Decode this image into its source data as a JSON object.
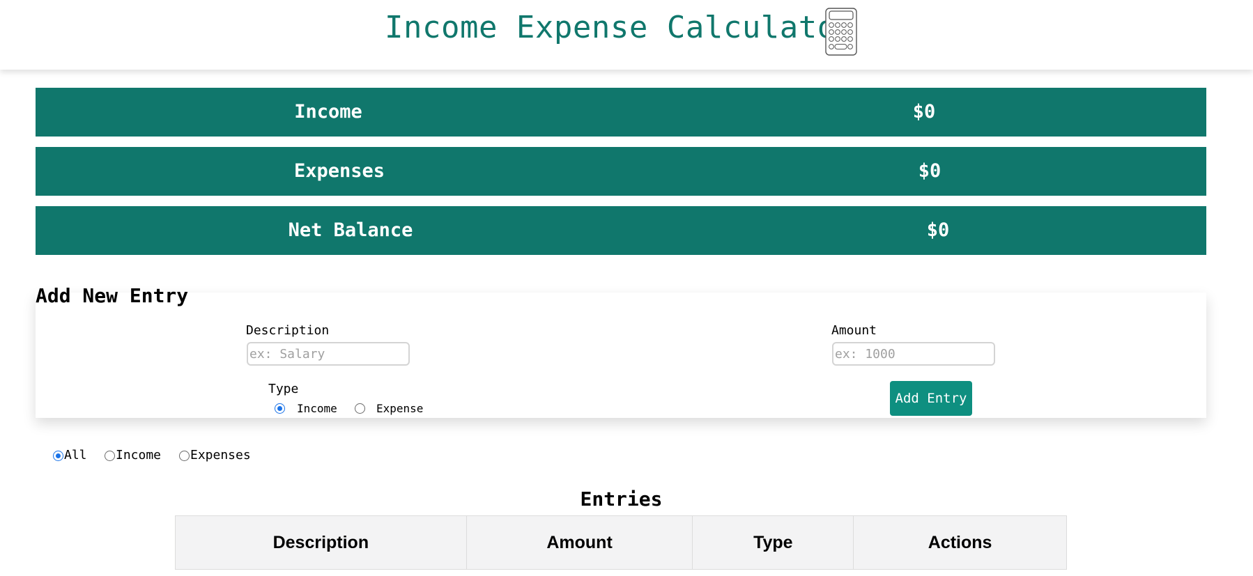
{
  "header": {
    "title": "Income Expense Calculator",
    "icon": "calculator-icon"
  },
  "summary": {
    "income": {
      "label": "Income",
      "value": "$0"
    },
    "expenses": {
      "label": "Expenses",
      "value": "$0"
    },
    "net_balance": {
      "label": "Net Balance",
      "value": "$0"
    }
  },
  "form": {
    "title": "Add New Entry",
    "description_label": "Description",
    "description_placeholder": "ex: Salary",
    "description_value": "",
    "amount_label": "Amount",
    "amount_placeholder": "ex: 1000",
    "amount_value": "",
    "type_label": "Type",
    "type_options": [
      "Income",
      "Expense"
    ],
    "type_selected": "Income",
    "submit_label": "Add Entry"
  },
  "filter": {
    "options": [
      "All",
      "Income",
      "Expenses"
    ],
    "selected": "All"
  },
  "entries": {
    "title": "Entries",
    "columns": [
      "Description",
      "Amount",
      "Type",
      "Actions"
    ],
    "rows": []
  },
  "colors": {
    "primary": "#10776c",
    "button": "#0e8f80",
    "radio_accent": "#1a73e8",
    "table_header_bg": "#f3f3f4"
  }
}
